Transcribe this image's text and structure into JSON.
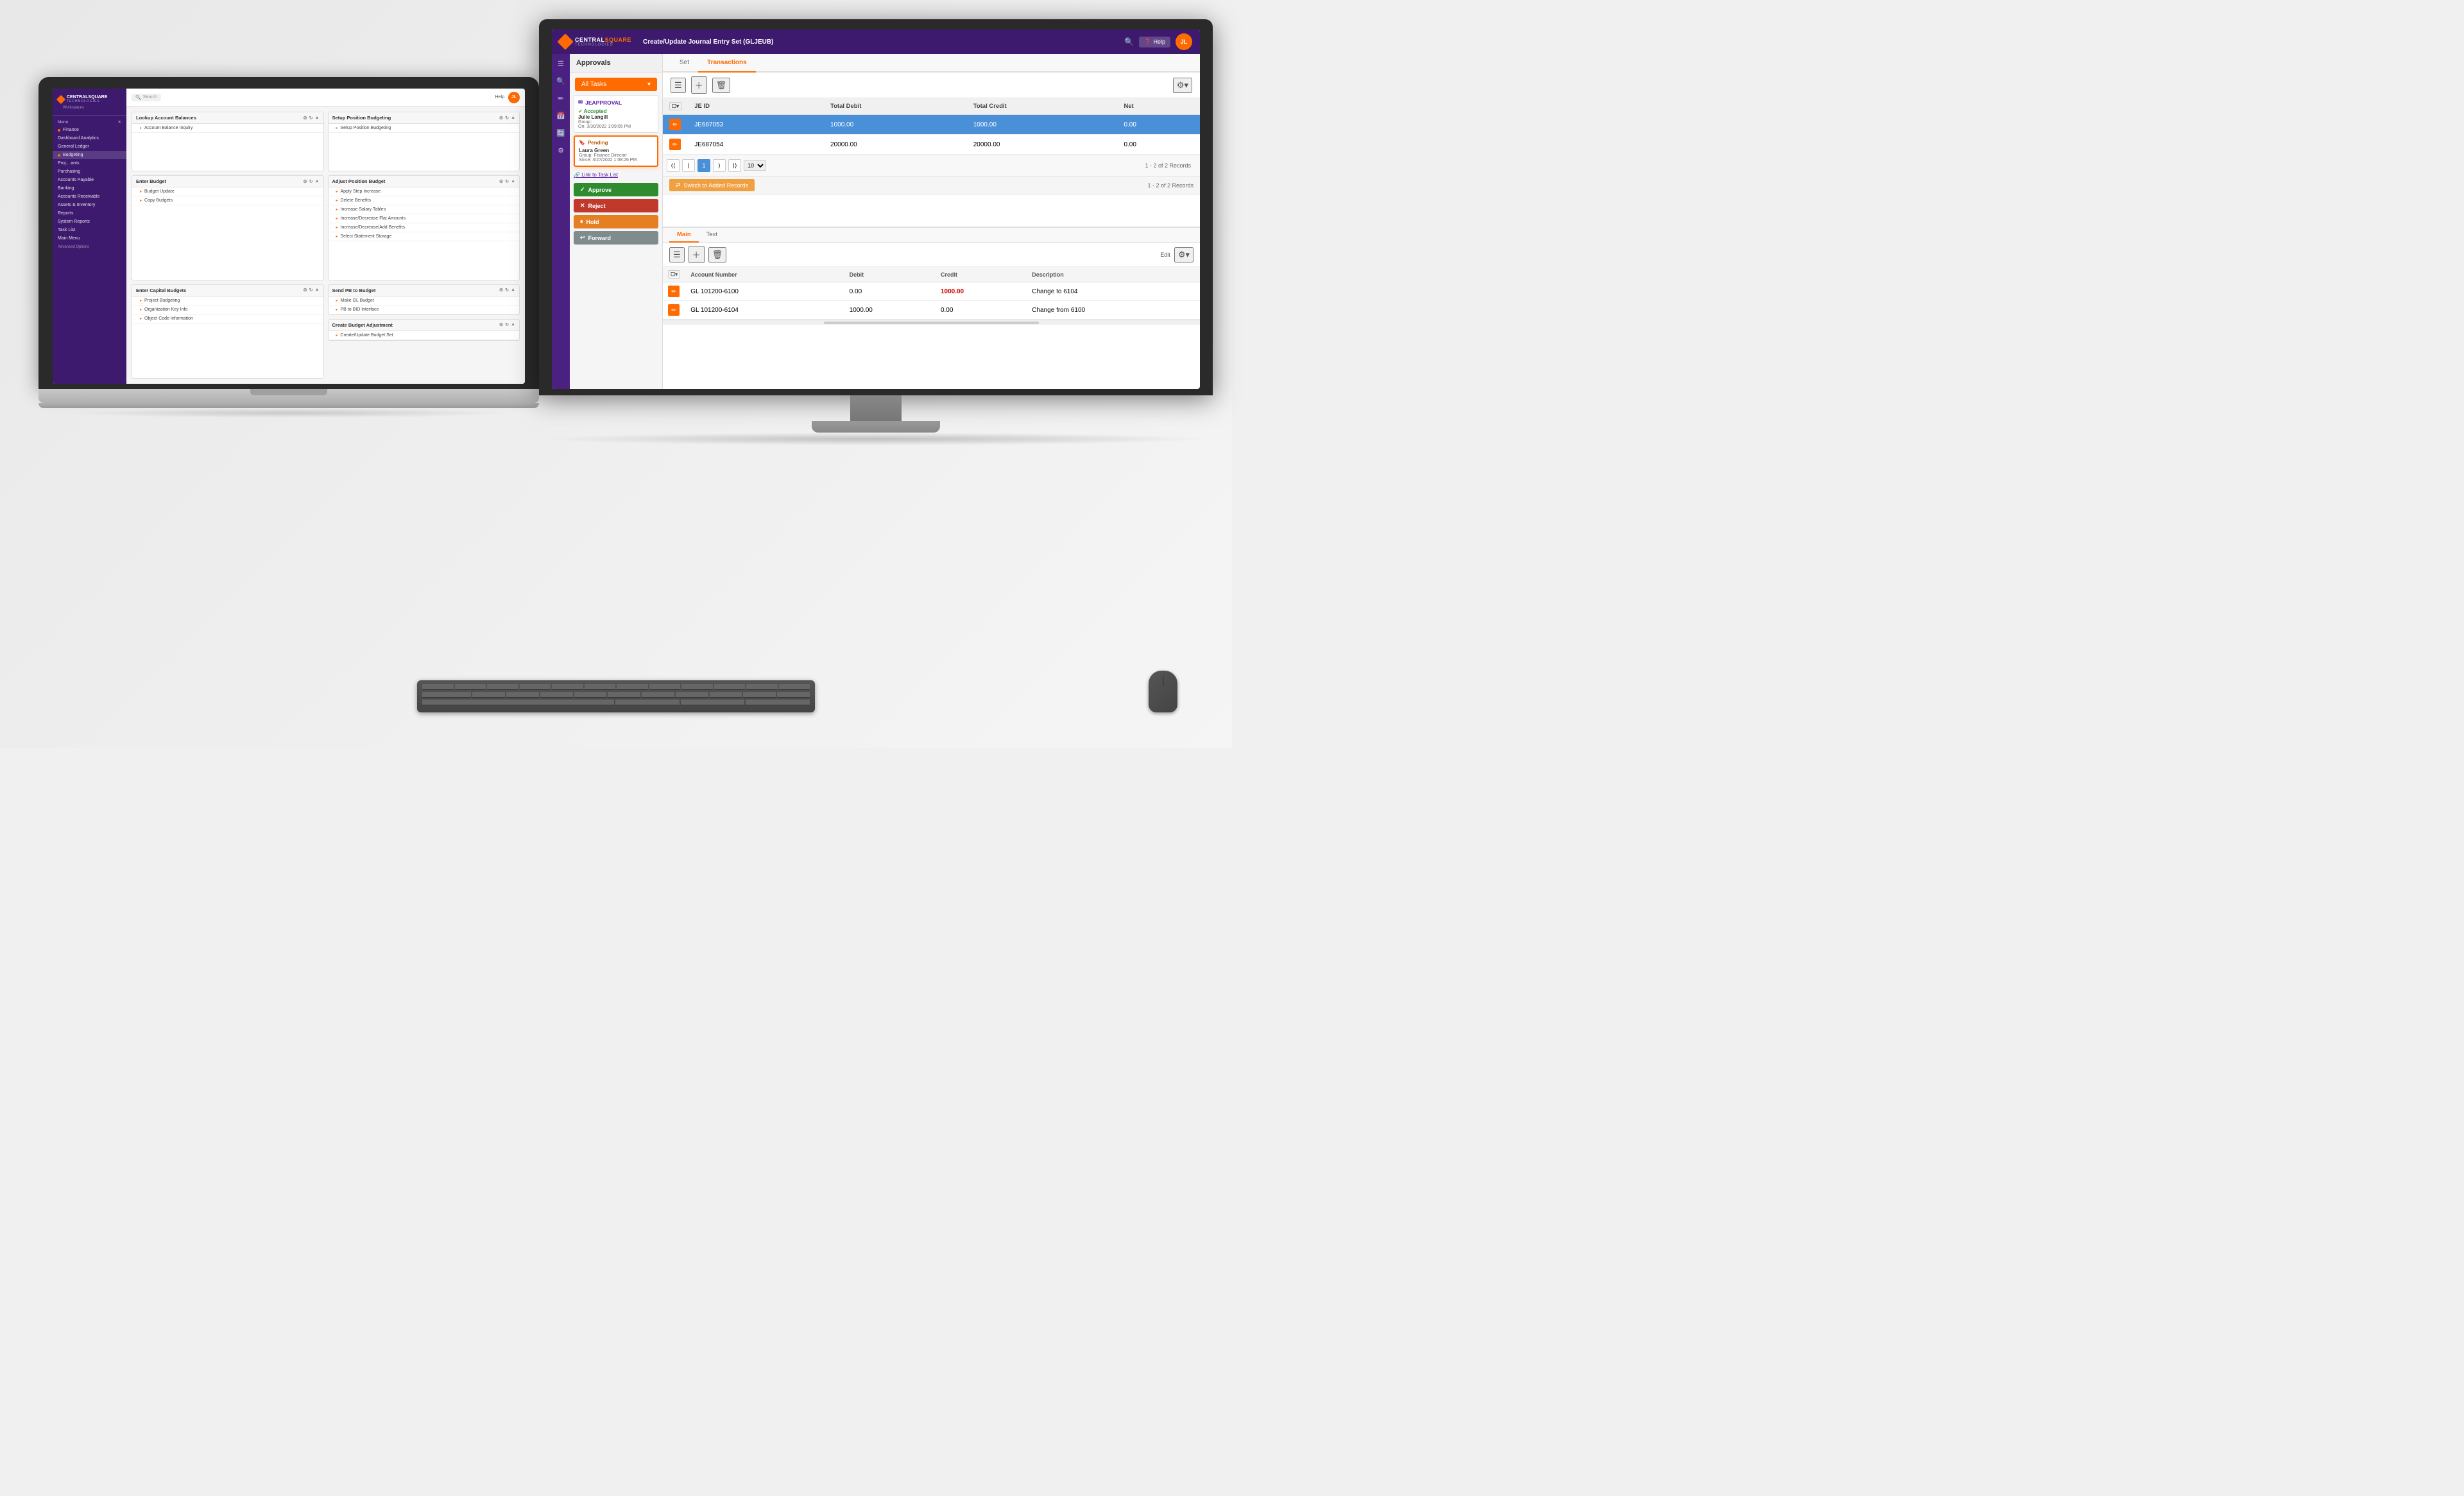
{
  "scene": {
    "background": "#f0f0f0"
  },
  "monitor": {
    "app_title": "Create/Update Journal Entry Set (GLJEUB)",
    "logo": {
      "brand": "CENTRALSQUARE",
      "sub": "TECHNOLOGIES"
    },
    "header": {
      "search_placeholder": "Search",
      "help_label": "Help",
      "user_initials": "JL"
    },
    "sidebar_icons": [
      "☰",
      "🔍",
      "✏",
      "📅",
      "🔄"
    ],
    "approvals": {
      "title": "Approvals",
      "all_tasks_label": "All Tasks",
      "app_name": "JEAPPROVAL",
      "cards": [
        {
          "status": "Accepted",
          "person": "Julie Langill",
          "detail": "Group:",
          "date": "On: 3/30/2022 1:09:05 PM"
        },
        {
          "status": "Pending",
          "person": "Laura Green",
          "detail": "Group: Finance Director",
          "date": "Since: 4/27/2022 1:09:26 PM"
        }
      ],
      "link_to_task": "Link to Task List",
      "buttons": {
        "approve": "Approve",
        "reject": "Reject",
        "hold": "Hold",
        "forward": "Forward"
      }
    },
    "tabs": {
      "set": "Set",
      "transactions": "Transactions"
    },
    "toolbar": {
      "icons": [
        "☰",
        "+",
        "🗑"
      ]
    },
    "table": {
      "columns": [
        "JE ID",
        "Total Debit",
        "Total Credit",
        "Net"
      ],
      "rows": [
        {
          "id": "JE687053",
          "total_debit": "1000.00",
          "total_credit": "1000.00",
          "net": "0.00",
          "selected": true
        },
        {
          "id": "JE687054",
          "total_debit": "20000.00",
          "total_credit": "20000.00",
          "net": "0.00",
          "selected": false
        }
      ]
    },
    "pagination": {
      "current": "1",
      "per_page": "10",
      "records_info": "1 - 2 of 2 Records"
    },
    "switch_records_label": "Switch to Added Records",
    "bottom_tabs": {
      "main": "Main",
      "text": "Text"
    },
    "bottom_toolbar": {
      "edit_label": "Edit",
      "icons": [
        "☰",
        "+",
        "🗑"
      ]
    },
    "detail_table": {
      "columns": [
        "Account Number",
        "Debit",
        "Credit",
        "Description"
      ],
      "rows": [
        {
          "account": "GL 101200-6100",
          "debit": "0.00",
          "credit": "1000.00",
          "description": "Change to 6104",
          "selected": true
        },
        {
          "account": "GL 101200-6104",
          "debit": "1000.00",
          "credit": "0.00",
          "description": "Change from 6100",
          "selected": false
        }
      ]
    }
  },
  "laptop": {
    "logo": {
      "brand": "CENTRALSQUARE",
      "sub": "TECHNOLOGIES",
      "workspace": "Workspaces"
    },
    "header": {
      "search_placeholder": "Search",
      "help_label": "Help",
      "user_initials": "JL"
    },
    "sidebar": {
      "menu_label": "Menu",
      "items": [
        {
          "label": "Finance",
          "active": false
        },
        {
          "label": "Dashboard Analytics",
          "active": false
        },
        {
          "label": "General Ledger",
          "active": false
        },
        {
          "label": "Budgeting",
          "active": true
        },
        {
          "label": "Proj... ants",
          "active": false
        },
        {
          "label": "Purchasing",
          "active": false
        },
        {
          "label": "Accounts Payable",
          "active": false
        },
        {
          "label": "Banking",
          "active": false
        },
        {
          "label": "Accounts Receivable",
          "active": false
        },
        {
          "label": "Assets & Inventory",
          "active": false
        },
        {
          "label": "Reports",
          "active": false
        },
        {
          "label": "System Reports",
          "active": false
        },
        {
          "label": "Task List",
          "active": false
        },
        {
          "label": "Main Menu",
          "active": false
        }
      ],
      "advanced_options": "Advanced Options"
    },
    "panels": {
      "lookup": {
        "title": "Lookup Account Balances",
        "items": [
          "Account Balance Inquiry"
        ]
      },
      "setup": {
        "title": "Setup Position Budgeting",
        "items": [
          "Setup Position Budgeting"
        ]
      },
      "enter_budget": {
        "title": "Enter Budget",
        "items": [
          "Budget Update",
          "Copy Budgets"
        ]
      },
      "adjust_position": {
        "title": "Adjust Position Budget",
        "items": [
          "Apply Step Increase",
          "Delete Benefits",
          "Increase Salary Tables",
          "Increase/Decrease Flat Amounts",
          "Increase/Decrease/Add Benefits",
          "Select Statement Storage"
        ]
      },
      "enter_capital": {
        "title": "Enter Capital Budgets",
        "items": [
          "Project Budgeting",
          "Organization Key Info",
          "Object Code Information"
        ]
      },
      "send_pb": {
        "title": "Send PB to Budget",
        "items": [
          "Make GL Budget",
          "PB to BID Interface"
        ]
      },
      "create_budget_adj": {
        "title": "Create Budget Adjustment",
        "items": [
          "Create/Update Budget Set"
        ]
      }
    }
  },
  "icons": {
    "diamond": "◆",
    "checkmark": "✓",
    "pencil": "✏",
    "link": "🔗",
    "arrow_right": "▸",
    "caret_down": "▾",
    "nav_first": "⟨⟨",
    "nav_prev": "⟨",
    "nav_next": "⟩",
    "nav_last": "⟩⟩",
    "exchange": "⇄",
    "forward_arrow": "↩"
  }
}
